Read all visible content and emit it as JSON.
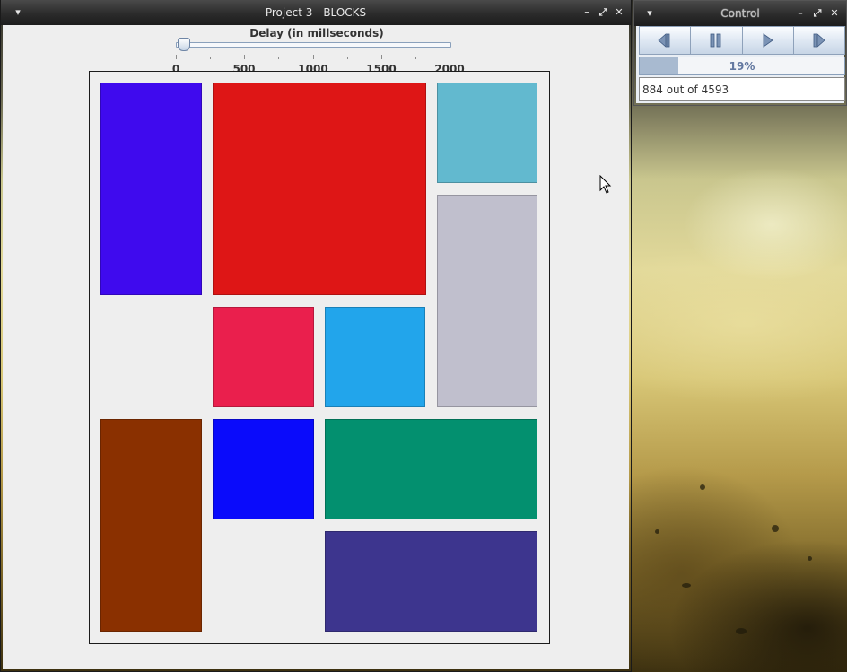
{
  "main_window": {
    "title": "Project 3 - BLOCKS",
    "slider": {
      "label": "Delay (in millseconds)",
      "min": 0,
      "max": 2000,
      "value": 50,
      "ticks": [
        "0",
        "500",
        "1000",
        "1500",
        "2000"
      ]
    },
    "blocks": [
      {
        "name": "block-purple",
        "color": "#3f0aee"
      },
      {
        "name": "block-red",
        "color": "#de1616"
      },
      {
        "name": "block-cyan",
        "color": "#62b9cf"
      },
      {
        "name": "block-silver",
        "color": "#c0bfcd"
      },
      {
        "name": "block-crimson",
        "color": "#ea1f4d"
      },
      {
        "name": "block-sky-blue",
        "color": "#22a5eb"
      },
      {
        "name": "block-brown",
        "color": "#8a3000"
      },
      {
        "name": "block-blue",
        "color": "#0a0bfb"
      },
      {
        "name": "block-green",
        "color": "#03906f"
      },
      {
        "name": "block-indigo",
        "color": "#3d358e"
      }
    ]
  },
  "control_window": {
    "title": "Control",
    "buttons": [
      {
        "name": "step-back-button",
        "icon": "step-back-icon"
      },
      {
        "name": "pause-button",
        "icon": "pause-icon"
      },
      {
        "name": "play-button",
        "icon": "play-icon"
      },
      {
        "name": "step-forward-button",
        "icon": "step-forward-icon"
      }
    ],
    "progress": {
      "percent": 19,
      "text": "19%"
    },
    "counter": "884 out of 4593"
  },
  "colors": {
    "titlebar": "#2b2b2b",
    "window_bg": "#eeeeee",
    "accent": "#6378a0"
  }
}
